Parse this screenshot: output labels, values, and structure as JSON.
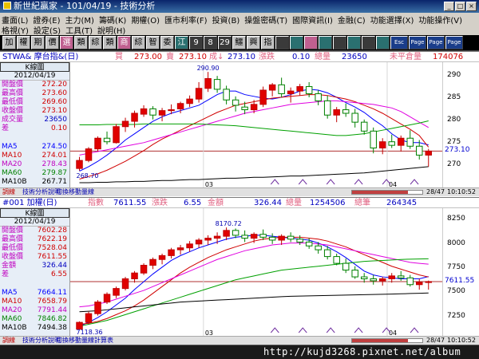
{
  "window": {
    "title": "新世紀贏家 - 101/04/19 - 技術分析",
    "buttons": [
      "_",
      "□",
      "×"
    ]
  },
  "menu": {
    "row1": [
      "畫面(L)",
      "證券(E)",
      "主力(M)",
      "籌碼(K)",
      "期權(O)",
      "匯市利率(F)",
      "投資(B)",
      "操盤密碼(T)",
      "國際資訊(I)",
      "金融(C)",
      "功能選擇(X)",
      "功能操作(V)"
    ],
    "row2": [
      "格視(Y)",
      "設定(S)",
      "工具(T)",
      "說明(H)"
    ]
  },
  "toolbar": {
    "buttons": [
      "加",
      "權",
      "期",
      "價",
      "選",
      "類",
      "綜",
      "類",
      "商",
      "綜",
      "智",
      "委",
      "江",
      "9",
      "8",
      "29",
      "鱷",
      "興",
      "指",
      "",
      "",
      "",
      "",
      "",
      "",
      "",
      "",
      "Esc",
      "Page",
      "Page",
      "Page"
    ]
  },
  "top": {
    "header": {
      "symbol": "STWA& 摩台指&(日)",
      "buy_label": "買",
      "buy": "273.00",
      "sell_label": "賣",
      "sell": "273.10",
      "last_label": "成↓",
      "last": "273.10",
      "chg_label": "漲跌",
      "chg": "0.10",
      "vol_label": "總量",
      "vol": "23650",
      "oi_label": "未平倉量",
      "oi": "174076"
    },
    "chart_label": "K線圖",
    "date": "2012/04/19",
    "stats": [
      {
        "label": "開盤價",
        "value": "272.20"
      },
      {
        "label": "最高價",
        "value": "273.60"
      },
      {
        "label": "最低價",
        "value": "269.60"
      },
      {
        "label": "收盤價",
        "value": "273.10"
      },
      {
        "label": "成交量",
        "value": "23650"
      },
      {
        "label": "差",
        "value": "0.10"
      }
    ],
    "ma": [
      {
        "label": "MA5",
        "value": "274.50"
      },
      {
        "label": "MA10",
        "value": "274.01"
      },
      {
        "label": "MA20",
        "value": "278.43"
      },
      {
        "label": "MA60",
        "value": "279.87"
      },
      {
        "label": "MA10B",
        "value": "267.71"
      }
    ],
    "y_ticks": [
      "290",
      "285",
      "280",
      "275",
      "270"
    ],
    "current": "273.10",
    "high_label": "290.90",
    "low_label": "268.70",
    "months": [
      "03",
      "04"
    ],
    "footer": {
      "rl": "調線",
      "link1": "技術分析說明",
      "link2": "切換移動量線",
      "zoom": "28/47",
      "time": "10:10:52"
    }
  },
  "bottom": {
    "header": {
      "symbol": "#001 加權(日)",
      "idx_label": "指數",
      "idx": "7611.55",
      "chg_label": "漲跌",
      "chg": "6.55",
      "amt_label": "金額",
      "amt": "326.44",
      "vol_label": "總量",
      "vol": "1254506",
      "cnt_label": "總筆",
      "cnt": "264345"
    },
    "chart_label": "K線圖",
    "date": "2012/04/19",
    "stats": [
      {
        "label": "開盤價",
        "value": "7602.28"
      },
      {
        "label": "最高價",
        "value": "7622.19"
      },
      {
        "label": "最低價",
        "value": "7528.04"
      },
      {
        "label": "收盤價",
        "value": "7611.55"
      },
      {
        "label": "金額",
        "value": "326.44"
      },
      {
        "label": "差",
        "value": "6.55"
      }
    ],
    "ma": [
      {
        "label": "MA5",
        "value": "7664.11"
      },
      {
        "label": "MA10",
        "value": "7658.79"
      },
      {
        "label": "MA20",
        "value": "7791.44"
      },
      {
        "label": "MA60",
        "value": "7846.82"
      },
      {
        "label": "MA10B",
        "value": "7494.38"
      }
    ],
    "y_ticks": [
      "8250",
      "8000",
      "7750",
      "7500",
      "7250"
    ],
    "current": "7611.55",
    "high_label": "8170.72",
    "low_label": "7118.36",
    "months": [
      "03",
      "04"
    ],
    "footer": {
      "rl": "調線",
      "link1": "技術分析說明",
      "link2": "切換移動量線計算表",
      "zoom": "28/47",
      "time": "10:10:52"
    }
  },
  "watermark": "http://kujd3268.pixnet.net/album",
  "colors": {
    "ma5": "#0000ff",
    "ma10": "#d00000",
    "ma20": "#e000e0",
    "ma60": "#00a000",
    "ma100": "#000000",
    "baseline": "#b03030"
  },
  "chart_data": [
    {
      "type": "candlestick",
      "title": "STWA& 摩台指&(日)",
      "xlabel": "",
      "ylabel": "",
      "x_tick_labels": [
        "03",
        "04"
      ],
      "ylim": [
        266,
        292
      ],
      "high_annot": 290.9,
      "low_annot": 268.7,
      "candles": [
        [
          269.2,
          271.8,
          268.7,
          271.0
        ],
        [
          271.0,
          274.0,
          270.6,
          273.6
        ],
        [
          273.6,
          276.4,
          273.0,
          276.0
        ],
        [
          276.0,
          277.5,
          274.6,
          275.2
        ],
        [
          275.0,
          279.2,
          274.8,
          278.6
        ],
        [
          278.6,
          280.6,
          277.4,
          279.8
        ],
        [
          279.8,
          282.2,
          278.4,
          281.6
        ],
        [
          281.4,
          283.4,
          280.8,
          282.6
        ],
        [
          282.6,
          283.2,
          280.2,
          281.2
        ],
        [
          281.2,
          282.8,
          279.8,
          282.2
        ],
        [
          282.2,
          283.6,
          281.4,
          282.4
        ],
        [
          282.6,
          284.2,
          281.6,
          283.8
        ],
        [
          283.8,
          285.6,
          283.0,
          284.8
        ],
        [
          284.8,
          288.6,
          284.0,
          287.2
        ],
        [
          287.2,
          290.9,
          286.4,
          289.4
        ],
        [
          289.2,
          290.0,
          286.2,
          287.0
        ],
        [
          287.0,
          287.8,
          283.6,
          284.6
        ],
        [
          284.6,
          285.4,
          282.0,
          283.4
        ],
        [
          283.0,
          284.2,
          281.4,
          282.4
        ],
        [
          282.4,
          284.6,
          281.6,
          283.6
        ],
        [
          283.6,
          287.6,
          283.0,
          286.8
        ],
        [
          286.8,
          288.4,
          285.4,
          288.0
        ],
        [
          288.0,
          289.6,
          285.2,
          286.0
        ],
        [
          286.0,
          287.4,
          284.0,
          286.6
        ],
        [
          286.6,
          288.2,
          285.6,
          287.6
        ],
        [
          287.6,
          288.6,
          285.2,
          286.0
        ],
        [
          286.0,
          286.8,
          283.4,
          284.4
        ],
        [
          284.4,
          285.6,
          280.4,
          281.2
        ],
        [
          281.2,
          283.0,
          279.6,
          282.4
        ],
        [
          282.4,
          283.8,
          280.8,
          281.6
        ],
        [
          281.6,
          282.6,
          278.4,
          279.6
        ],
        [
          279.6,
          280.2,
          276.8,
          277.6
        ],
        [
          277.6,
          278.4,
          272.6,
          273.8
        ],
        [
          273.8,
          276.0,
          272.4,
          275.2
        ],
        [
          275.2,
          276.8,
          273.8,
          274.4
        ],
        [
          274.4,
          276.6,
          273.0,
          276.0
        ],
        [
          276.0,
          277.8,
          273.6,
          274.2
        ],
        [
          274.2,
          275.6,
          271.2,
          272.2
        ],
        [
          272.2,
          273.6,
          269.6,
          273.1
        ]
      ],
      "series": [
        {
          "name": "MA5",
          "values": [
            268.6,
            269.6,
            270.8,
            272.2,
            273.8,
            275.6,
            277.0,
            278.4,
            279.8,
            280.8,
            281.6,
            282.2,
            282.8,
            283.4,
            284.6,
            285.8,
            286.6,
            286.6,
            285.8,
            285.4,
            285.0,
            284.8,
            285.2,
            285.8,
            286.6,
            287.0,
            286.8,
            286.2,
            285.2,
            284.0,
            283.0,
            281.8,
            280.2,
            278.8,
            277.0,
            275.6,
            275.0,
            275.0,
            274.5
          ]
        },
        {
          "name": "MA10",
          "values": [
            266.8,
            267.4,
            268.0,
            268.8,
            269.8,
            270.8,
            272.0,
            273.2,
            274.6,
            275.8,
            276.8,
            277.8,
            278.8,
            279.8,
            280.8,
            281.8,
            282.6,
            283.4,
            283.8,
            284.2,
            284.6,
            285.0,
            285.2,
            285.4,
            285.6,
            285.8,
            285.8,
            285.6,
            285.2,
            284.8,
            284.2,
            283.4,
            282.6,
            281.6,
            280.4,
            279.2,
            278.0,
            276.6,
            274.0
          ]
        },
        {
          "name": "MA20",
          "values": [
            272.2,
            272.6,
            273.0,
            273.4,
            273.8,
            274.2,
            274.6,
            275.0,
            275.6,
            276.2,
            276.8,
            277.4,
            278.0,
            278.6,
            279.2,
            279.8,
            280.4,
            281.0,
            281.6,
            282.0,
            282.4,
            282.8,
            283.2,
            283.6,
            283.8,
            284.0,
            284.2,
            284.4,
            284.4,
            284.2,
            284.0,
            283.8,
            283.6,
            283.2,
            282.8,
            282.0,
            280.8,
            279.6,
            278.4
          ]
        },
        {
          "name": "MA60",
          "values": [
            279.0,
            279.0,
            279.0,
            279.1,
            279.1,
            279.1,
            279.1,
            279.2,
            279.2,
            279.2,
            279.2,
            279.2,
            279.2,
            279.2,
            279.1,
            279.0,
            278.9,
            278.8,
            278.6,
            278.4,
            278.2,
            278.0,
            277.8,
            277.6,
            277.4,
            277.2,
            277.0,
            276.8,
            276.6,
            276.6,
            276.8,
            277.0,
            277.4,
            277.8,
            278.2,
            278.6,
            279.0,
            279.4,
            279.9
          ]
        },
        {
          "name": "MA100",
          "values": [
            266.0,
            266.0,
            266.1,
            266.1,
            266.2,
            266.2,
            266.3,
            266.3,
            266.4,
            266.5,
            266.5,
            266.6,
            266.7,
            266.7,
            266.8,
            266.9,
            267.0,
            267.0,
            267.1,
            267.2,
            267.2,
            267.3,
            267.4,
            267.5,
            267.5,
            267.6,
            267.7,
            267.8,
            267.9,
            268.0,
            268.1,
            268.2,
            268.4,
            268.6,
            268.8,
            269.0,
            269.2,
            269.4,
            269.6
          ]
        }
      ],
      "reference_line": 273.1
    },
    {
      "type": "candlestick",
      "title": "#001 加權(日)",
      "xlabel": "",
      "ylabel": "",
      "x_tick_labels": [
        "03",
        "04"
      ],
      "ylim": [
        7100,
        8320
      ],
      "high_annot": 8170.72,
      "low_annot": 7118.36,
      "candles": [
        [
          7120,
          7200,
          7118,
          7190
        ],
        [
          7190,
          7300,
          7170,
          7280
        ],
        [
          7280,
          7420,
          7260,
          7400
        ],
        [
          7400,
          7500,
          7380,
          7480
        ],
        [
          7470,
          7560,
          7440,
          7540
        ],
        [
          7540,
          7660,
          7520,
          7640
        ],
        [
          7640,
          7720,
          7600,
          7700
        ],
        [
          7700,
          7800,
          7680,
          7780
        ],
        [
          7780,
          7860,
          7740,
          7840
        ],
        [
          7840,
          7900,
          7790,
          7880
        ],
        [
          7880,
          7960,
          7850,
          7940
        ],
        [
          7940,
          7990,
          7890,
          7960
        ],
        [
          7960,
          8030,
          7920,
          8000
        ],
        [
          8000,
          8060,
          7960,
          8040
        ],
        [
          8040,
          8090,
          7990,
          8060
        ],
        [
          8060,
          8120,
          8000,
          8080
        ],
        [
          8080,
          8171,
          8040,
          8140
        ],
        [
          8140,
          8160,
          8060,
          8090
        ],
        [
          8090,
          8140,
          8020,
          8060
        ],
        [
          8060,
          8120,
          8010,
          8100
        ],
        [
          8100,
          8150,
          8040,
          8070
        ],
        [
          8070,
          8110,
          8000,
          8040
        ],
        [
          8040,
          8100,
          7990,
          8080
        ],
        [
          8080,
          8120,
          8020,
          8050
        ],
        [
          8050,
          8090,
          7990,
          8020
        ],
        [
          8020,
          8060,
          7950,
          7980
        ],
        [
          7980,
          8020,
          7900,
          7940
        ],
        [
          7940,
          7980,
          7840,
          7870
        ],
        [
          7870,
          7900,
          7780,
          7800
        ],
        [
          7800,
          7850,
          7700,
          7730
        ],
        [
          7730,
          7770,
          7640,
          7660
        ],
        [
          7660,
          7700,
          7600,
          7640
        ],
        [
          7640,
          7680,
          7580,
          7620
        ],
        [
          7620,
          7660,
          7570,
          7640
        ],
        [
          7640,
          7700,
          7600,
          7670
        ],
        [
          7670,
          7720,
          7620,
          7650
        ],
        [
          7650,
          7680,
          7560,
          7580
        ],
        [
          7580,
          7640,
          7528,
          7605
        ],
        [
          7602,
          7622,
          7528,
          7611.55
        ]
      ],
      "series": [
        {
          "name": "MA5",
          "values": [
            7150,
            7190,
            7240,
            7300,
            7370,
            7440,
            7530,
            7610,
            7690,
            7760,
            7830,
            7880,
            7920,
            7960,
            7990,
            8020,
            8050,
            8070,
            8080,
            8090,
            8090,
            8080,
            8070,
            8060,
            8050,
            8040,
            8010,
            7970,
            7920,
            7860,
            7790,
            7720,
            7680,
            7660,
            7650,
            7640,
            7640,
            7640,
            7664
          ]
        },
        {
          "name": "MA10",
          "values": [
            7170,
            7180,
            7200,
            7230,
            7270,
            7310,
            7360,
            7420,
            7490,
            7560,
            7630,
            7700,
            7760,
            7810,
            7860,
            7900,
            7940,
            7970,
            8000,
            8030,
            8050,
            8060,
            8070,
            8070,
            8070,
            8060,
            8050,
            8030,
            8000,
            7970,
            7930,
            7890,
            7850,
            7810,
            7770,
            7740,
            7710,
            7680,
            7659
          ]
        },
        {
          "name": "MA20",
          "values": [
            7350,
            7360,
            7380,
            7400,
            7430,
            7460,
            7490,
            7520,
            7560,
            7600,
            7640,
            7680,
            7720,
            7760,
            7800,
            7840,
            7870,
            7900,
            7930,
            7950,
            7970,
            7990,
            8000,
            8010,
            8010,
            8010,
            8000,
            7990,
            7970,
            7950,
            7930,
            7910,
            7890,
            7870,
            7850,
            7830,
            7810,
            7800,
            7791
          ]
        },
        {
          "name": "MA60",
          "values": [
            7150,
            7170,
            7190,
            7210,
            7240,
            7270,
            7300,
            7330,
            7360,
            7390,
            7420,
            7450,
            7480,
            7510,
            7540,
            7570,
            7600,
            7630,
            7650,
            7670,
            7690,
            7710,
            7730,
            7740,
            7750,
            7760,
            7770,
            7780,
            7790,
            7800,
            7810,
            7820,
            7825,
            7830,
            7835,
            7840,
            7843,
            7845,
            7847
          ]
        },
        {
          "name": "MA100",
          "values": [
            7300,
            7305,
            7310,
            7320,
            7330,
            7340,
            7350,
            7360,
            7370,
            7380,
            7390,
            7400,
            7405,
            7410,
            7415,
            7420,
            7425,
            7430,
            7435,
            7440,
            7445,
            7450,
            7455,
            7460,
            7462,
            7464,
            7466,
            7468,
            7470,
            7472,
            7474,
            7476,
            7478,
            7480,
            7482,
            7485,
            7488,
            7491,
            7494
          ]
        }
      ],
      "reference_line": 7611.55
    }
  ]
}
